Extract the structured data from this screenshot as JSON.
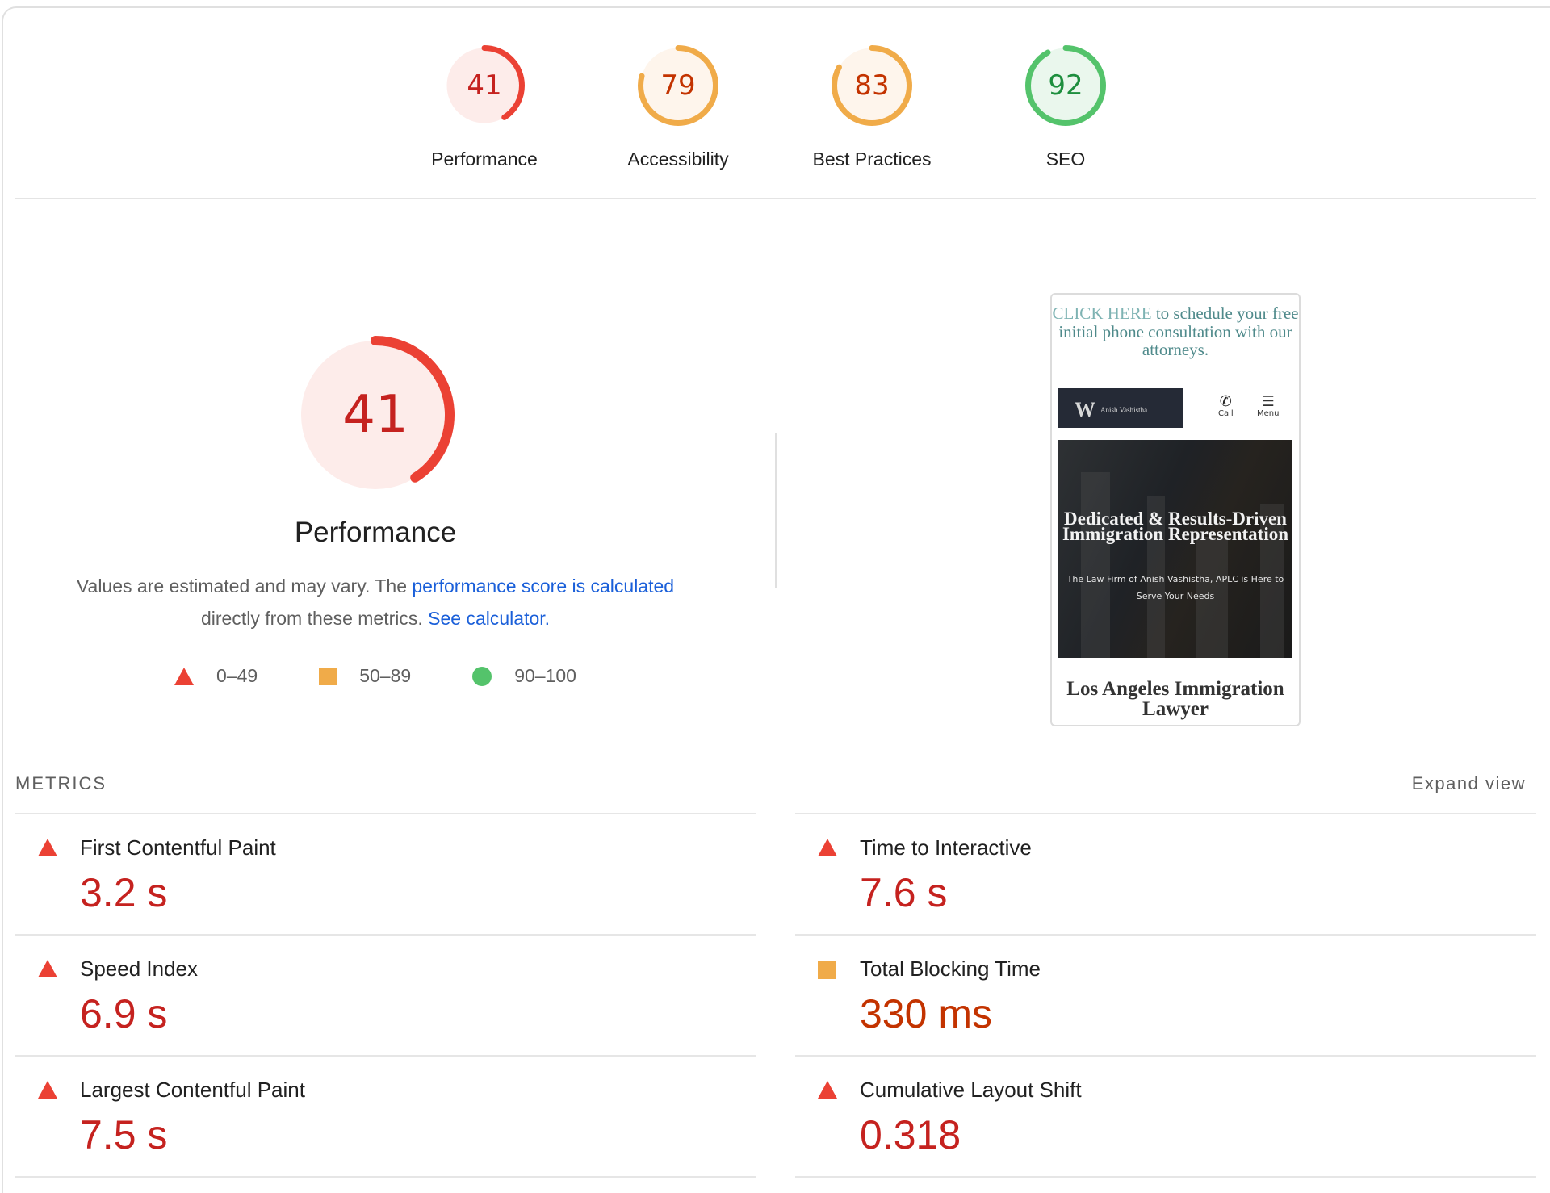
{
  "colors": {
    "fail": "#eb4134",
    "fail_text": "#c5221f",
    "fail_bg": "#fdecea",
    "average": "#f0ab49",
    "average_text": "#c33300",
    "average_bg": "#fef5ec",
    "pass": "#54c36b",
    "pass_text": "#1e8e3e",
    "pass_bg": "#eaf7ed",
    "link": "#1a5fd9"
  },
  "summary": {
    "categories": [
      {
        "label": "Performance",
        "score": 41,
        "rating": "fail"
      },
      {
        "label": "Accessibility",
        "score": 79,
        "rating": "average"
      },
      {
        "label": "Best Practices",
        "score": 83,
        "rating": "average"
      },
      {
        "label": "SEO",
        "score": 92,
        "rating": "pass"
      }
    ]
  },
  "performance": {
    "score": 41,
    "title": "Performance",
    "desc_prefix": "Values are estimated and may vary. The ",
    "desc_link1": "performance score is calculated",
    "desc_mid": "directly from these metrics.",
    "desc_link2": "See calculator.",
    "legend": [
      {
        "icon": "triangle-icon",
        "range": "0–49"
      },
      {
        "icon": "square-icon",
        "range": "50–89"
      },
      {
        "icon": "circle-icon",
        "range": "90–100"
      }
    ]
  },
  "screenshot": {
    "promo_highlight": "CLICK HERE",
    "promo_rest": " to schedule your free initial phone consultation with our attorneys.",
    "logo_mark": "W",
    "logo_name": "Anish Vashistha",
    "call_label": "Call",
    "menu_label": "Menu",
    "hero_title": "Dedicated & Results-Driven Immigration Representation",
    "hero_subtitle": "The Law Firm of Anish Vashistha, APLC is Here to Serve Your Needs",
    "page_title": "Los Angeles Immigration Lawyer"
  },
  "metrics": {
    "header": "METRICS",
    "expand_label": "Expand view",
    "left": [
      {
        "name": "First Contentful Paint",
        "value": "3.2 s",
        "rating": "fail"
      },
      {
        "name": "Speed Index",
        "value": "6.9 s",
        "rating": "fail"
      },
      {
        "name": "Largest Contentful Paint",
        "value": "7.5 s",
        "rating": "fail"
      }
    ],
    "right": [
      {
        "name": "Time to Interactive",
        "value": "7.6 s",
        "rating": "fail"
      },
      {
        "name": "Total Blocking Time",
        "value": "330 ms",
        "rating": "average"
      },
      {
        "name": "Cumulative Layout Shift",
        "value": "0.318",
        "rating": "fail"
      }
    ]
  }
}
